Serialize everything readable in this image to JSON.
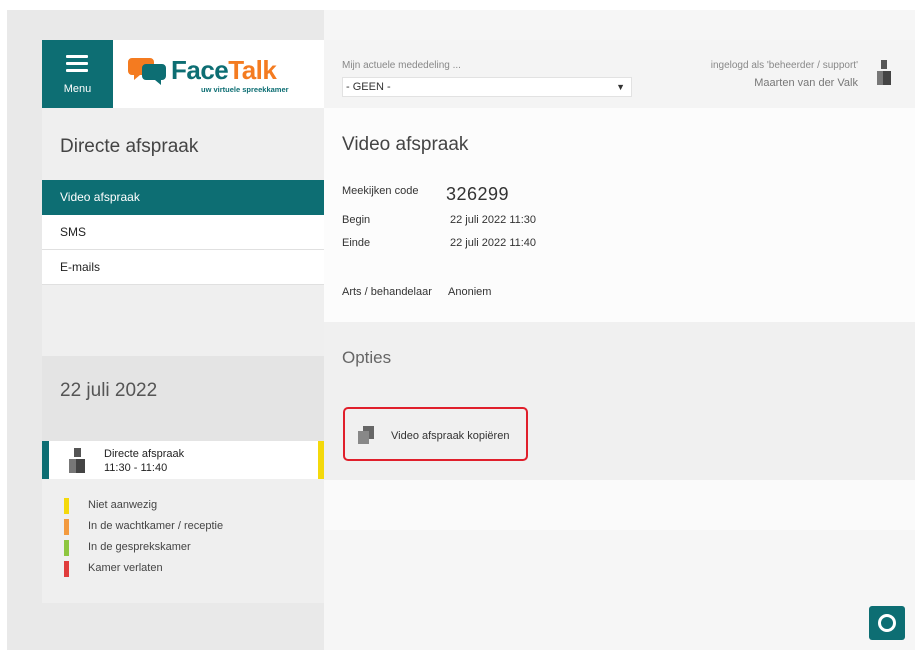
{
  "sidebar": {
    "menu_label": "Menu",
    "logo_text_a": "Face",
    "logo_text_b": "Talk",
    "logo_tagline": "uw virtuele spreekkamer",
    "section_title": "Directe afspraak",
    "nav": [
      {
        "label": "Video afspraak",
        "active": true
      },
      {
        "label": "SMS"
      },
      {
        "label": "E-mails"
      }
    ],
    "date": "22 juli 2022",
    "appointment": {
      "title": "Directe afspraak",
      "time": "11:30 - 11:40"
    },
    "legend": [
      {
        "label": "Niet aanwezig",
        "color": "#f4d90b"
      },
      {
        "label": "In de wachtkamer / receptie",
        "color": "#f39a3e"
      },
      {
        "label": "In de gesprekskamer",
        "color": "#8dc63f"
      },
      {
        "label": "Kamer verlaten",
        "color": "#e03c3c"
      }
    ]
  },
  "header": {
    "message_label": "Mijn actuele mededeling ...",
    "message_value": "- GEEN -",
    "login_info": "ingelogd als 'beheerder / support'",
    "user_name": "Maarten van der Valk"
  },
  "main": {
    "title": "Video afspraak",
    "code_label": "Meekijken code",
    "code_value": "326299",
    "begin_label": "Begin",
    "begin_value": "22 juli 2022 11:30",
    "end_label": "Einde",
    "end_value": "22 juli 2022 11:40",
    "doctor_label": "Arts / behandelaar",
    "doctor_value": "Anoniem"
  },
  "options": {
    "title": "Opties",
    "copy_label": "Video afspraak kopiëren"
  },
  "colors": {
    "brand": "#0d6e73",
    "accent": "#f47b20",
    "highlight": "#e01f2b"
  }
}
